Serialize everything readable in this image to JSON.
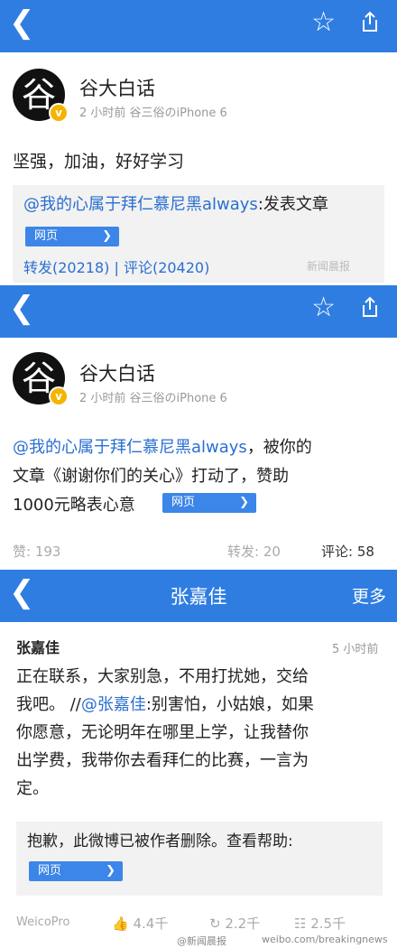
{
  "card1": {
    "user": "谷大白话",
    "avatar_char": "谷",
    "badge": "v",
    "meta": "2 小时前  谷三俗のiPhone 6",
    "text": "坚强，加油，好好学习",
    "repost_user": "@我的心属于拜仁慕尼黑always",
    "repost_text": ":发表文章",
    "web_label": "网页",
    "stats": "转发(20218) | 评论(20420)",
    "watermark": "新闻晨报"
  },
  "card2": {
    "user": "谷大白话",
    "avatar_char": "谷",
    "badge": "v",
    "meta": "2 小时前  谷三俗のiPhone 6",
    "text_link": "@我的心属于拜仁慕尼黑always",
    "text_line1_rest": "，被你的",
    "text_line2": "文章《谢谢你们的关心》打动了，赞助",
    "text_line3": "1000元略表心意",
    "web_label": "网页",
    "likes": "赞: 193",
    "reposts": "转发: 20",
    "comments": "评论: 58"
  },
  "card3": {
    "title": "张嘉佳",
    "more": "更多",
    "user": "张嘉佳",
    "time": "5 小时前",
    "text_lines": [
      "正在联系，大家别急，不用打扰她，交给",
      "我吧。 //",
      "你愿意，无论明年在哪里上学，让我替你",
      "出学费，我带你去看拜仁的比赛，一言为",
      "定。"
    ],
    "mention": "@张嘉佳",
    "mention_rest": ":别害怕，小姑娘，如果",
    "deleted": "抱歉，此微博已被作者删除。查看帮助:",
    "web_label": "网页",
    "client": "WeicoPro",
    "likes": "4.4千",
    "reposts": "2.2千",
    "comments": "2.5千",
    "watermark_left": "@新闻晨报",
    "watermark_right": "weibo.com/breakingnews"
  },
  "colors": {
    "bar": "#2f7de1",
    "link": "#2a6fd0",
    "badge": "#f5b400"
  }
}
